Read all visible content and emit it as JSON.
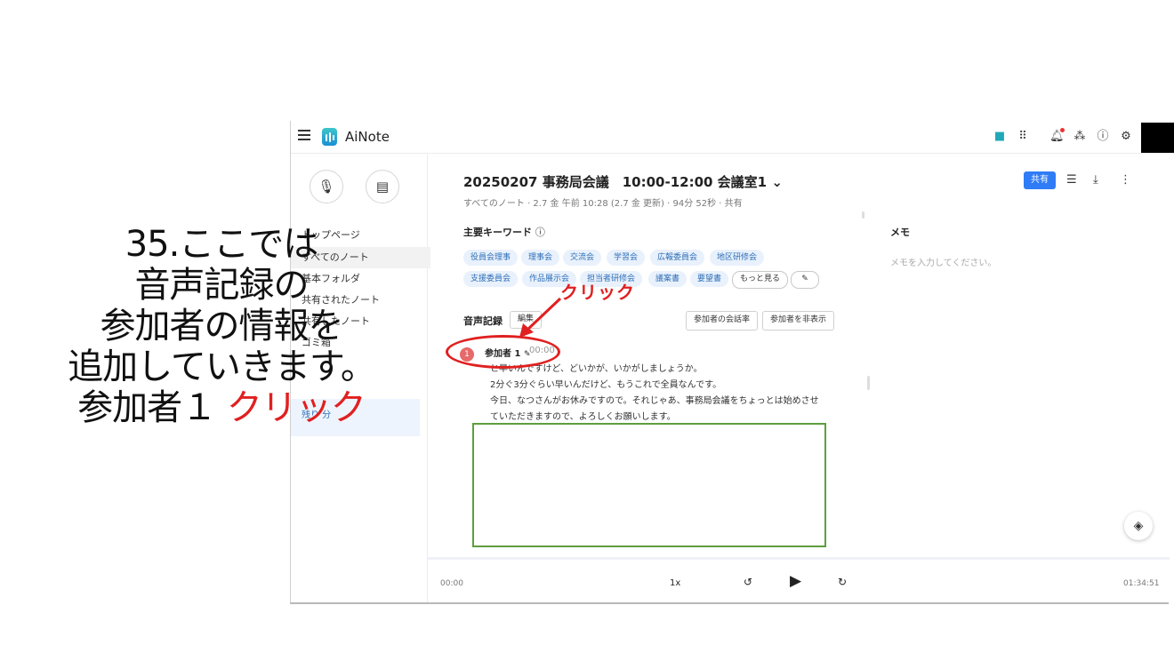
{
  "app": {
    "name": "AiNote",
    "title": "20250207 事務局会議　10:00-12:00 会議室1",
    "meta": "すべてのノート · 2.7 金 午前 10:28 (2.7 金 更新) · 94分 52秒 · 共有"
  },
  "sidebar": {
    "items": [
      {
        "label": "トップページ"
      },
      {
        "label": "すべてのノート"
      },
      {
        "label": "基本フォルダ"
      },
      {
        "label": "共有されたノート"
      },
      {
        "label": "共有したノート"
      },
      {
        "label": "ゴミ箱"
      },
      {
        "label": "残り 分"
      }
    ]
  },
  "toolbar": {
    "share_label": "共有"
  },
  "keywords": {
    "title": "主要キーワード",
    "tags": [
      "役員会理事",
      "理事会",
      "交流会",
      "学習会",
      "広報委員会",
      "地区研修会",
      "支援委員会",
      "作品展示会",
      "担当者研修会",
      "議案書",
      "要望書"
    ],
    "more_label": "もっと見る"
  },
  "recording": {
    "title": "音声記録",
    "edit_label": "編集",
    "rate_label": "参加者の会話率",
    "hide_label": "参加者を非表示",
    "speaker": {
      "badge": "1",
      "name": "参加者 1",
      "time": "00:00"
    },
    "lines": [
      "と早いんですけど、どいかが、いかがしましょうか。",
      "2分ぐ3分ぐらい早いんだけど、もうこれで全員なんです。",
      "今日、なつさんがお休みですので。それじゃあ、事務局会議をちょっとは始めさせ",
      "ていただきますので、よろしくお願いします。"
    ]
  },
  "memo": {
    "title": "メモ",
    "placeholder": "メモを入力してください。"
  },
  "player": {
    "start": "00:00",
    "speed": "1x",
    "end": "01:34:51"
  },
  "annotation": {
    "lines": [
      "35.ここでは",
      "音声記録の",
      "参加者の情報を",
      "追加していきます。"
    ],
    "last_prefix": "参加者１",
    "last_click": "クリック",
    "click_label": "クリック"
  },
  "colors": {
    "accent": "#2f7cf6",
    "annotation_red": "#e02020",
    "highlight_box": "#5e9e3f"
  }
}
